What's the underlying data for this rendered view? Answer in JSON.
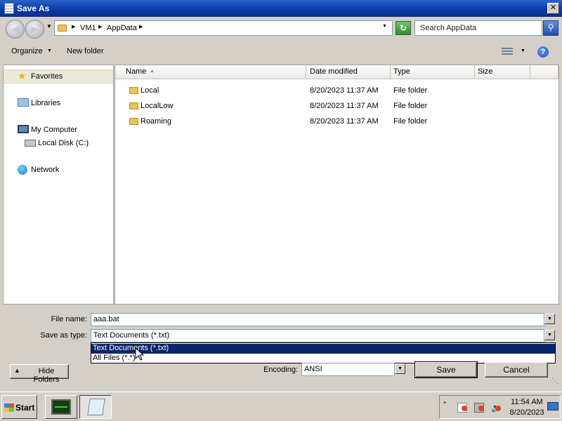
{
  "window": {
    "title": "Save As",
    "close_glyph": "✕"
  },
  "address_bar": {
    "crumbs": [
      "VM1",
      "AppData"
    ],
    "refresh_glyph": "↻"
  },
  "search": {
    "placeholder": "Search AppData"
  },
  "toolbar": {
    "organize": "Organize",
    "new_folder": "New folder",
    "help_glyph": "?"
  },
  "nav_pane": {
    "favorites": "Favorites",
    "libraries": "Libraries",
    "my_computer": "My Computer",
    "local_disk": "Local Disk (C:)",
    "network": "Network"
  },
  "file_list": {
    "columns": [
      "Name",
      "Date modified",
      "Type",
      "Size"
    ],
    "rows": [
      {
        "name": "Local",
        "date": "8/20/2023 11:37 AM",
        "type": "File folder",
        "size": ""
      },
      {
        "name": "LocalLow",
        "date": "8/20/2023 11:37 AM",
        "type": "File folder",
        "size": ""
      },
      {
        "name": "Roaming",
        "date": "8/20/2023 11:37 AM",
        "type": "File folder",
        "size": ""
      }
    ]
  },
  "form": {
    "file_name_label": "File name:",
    "file_name_value": "aaa.bat",
    "save_type_label": "Save as type:",
    "save_type_value": "Text Documents (*.txt)",
    "type_options": [
      "Text Documents (*.txt)",
      "All Files  (*.*)"
    ],
    "encoding_label": "Encoding:",
    "encoding_value": "ANSI",
    "save_button": "Save",
    "cancel_button": "Cancel",
    "hide_folders": "Hide Folders"
  },
  "taskbar": {
    "start": "Start",
    "time": "11:54 AM",
    "date": "8/20/2023"
  },
  "colors": {
    "title_bar": "#0a3aa8",
    "selection": "#0a246a",
    "folder": "#e8c25a"
  }
}
